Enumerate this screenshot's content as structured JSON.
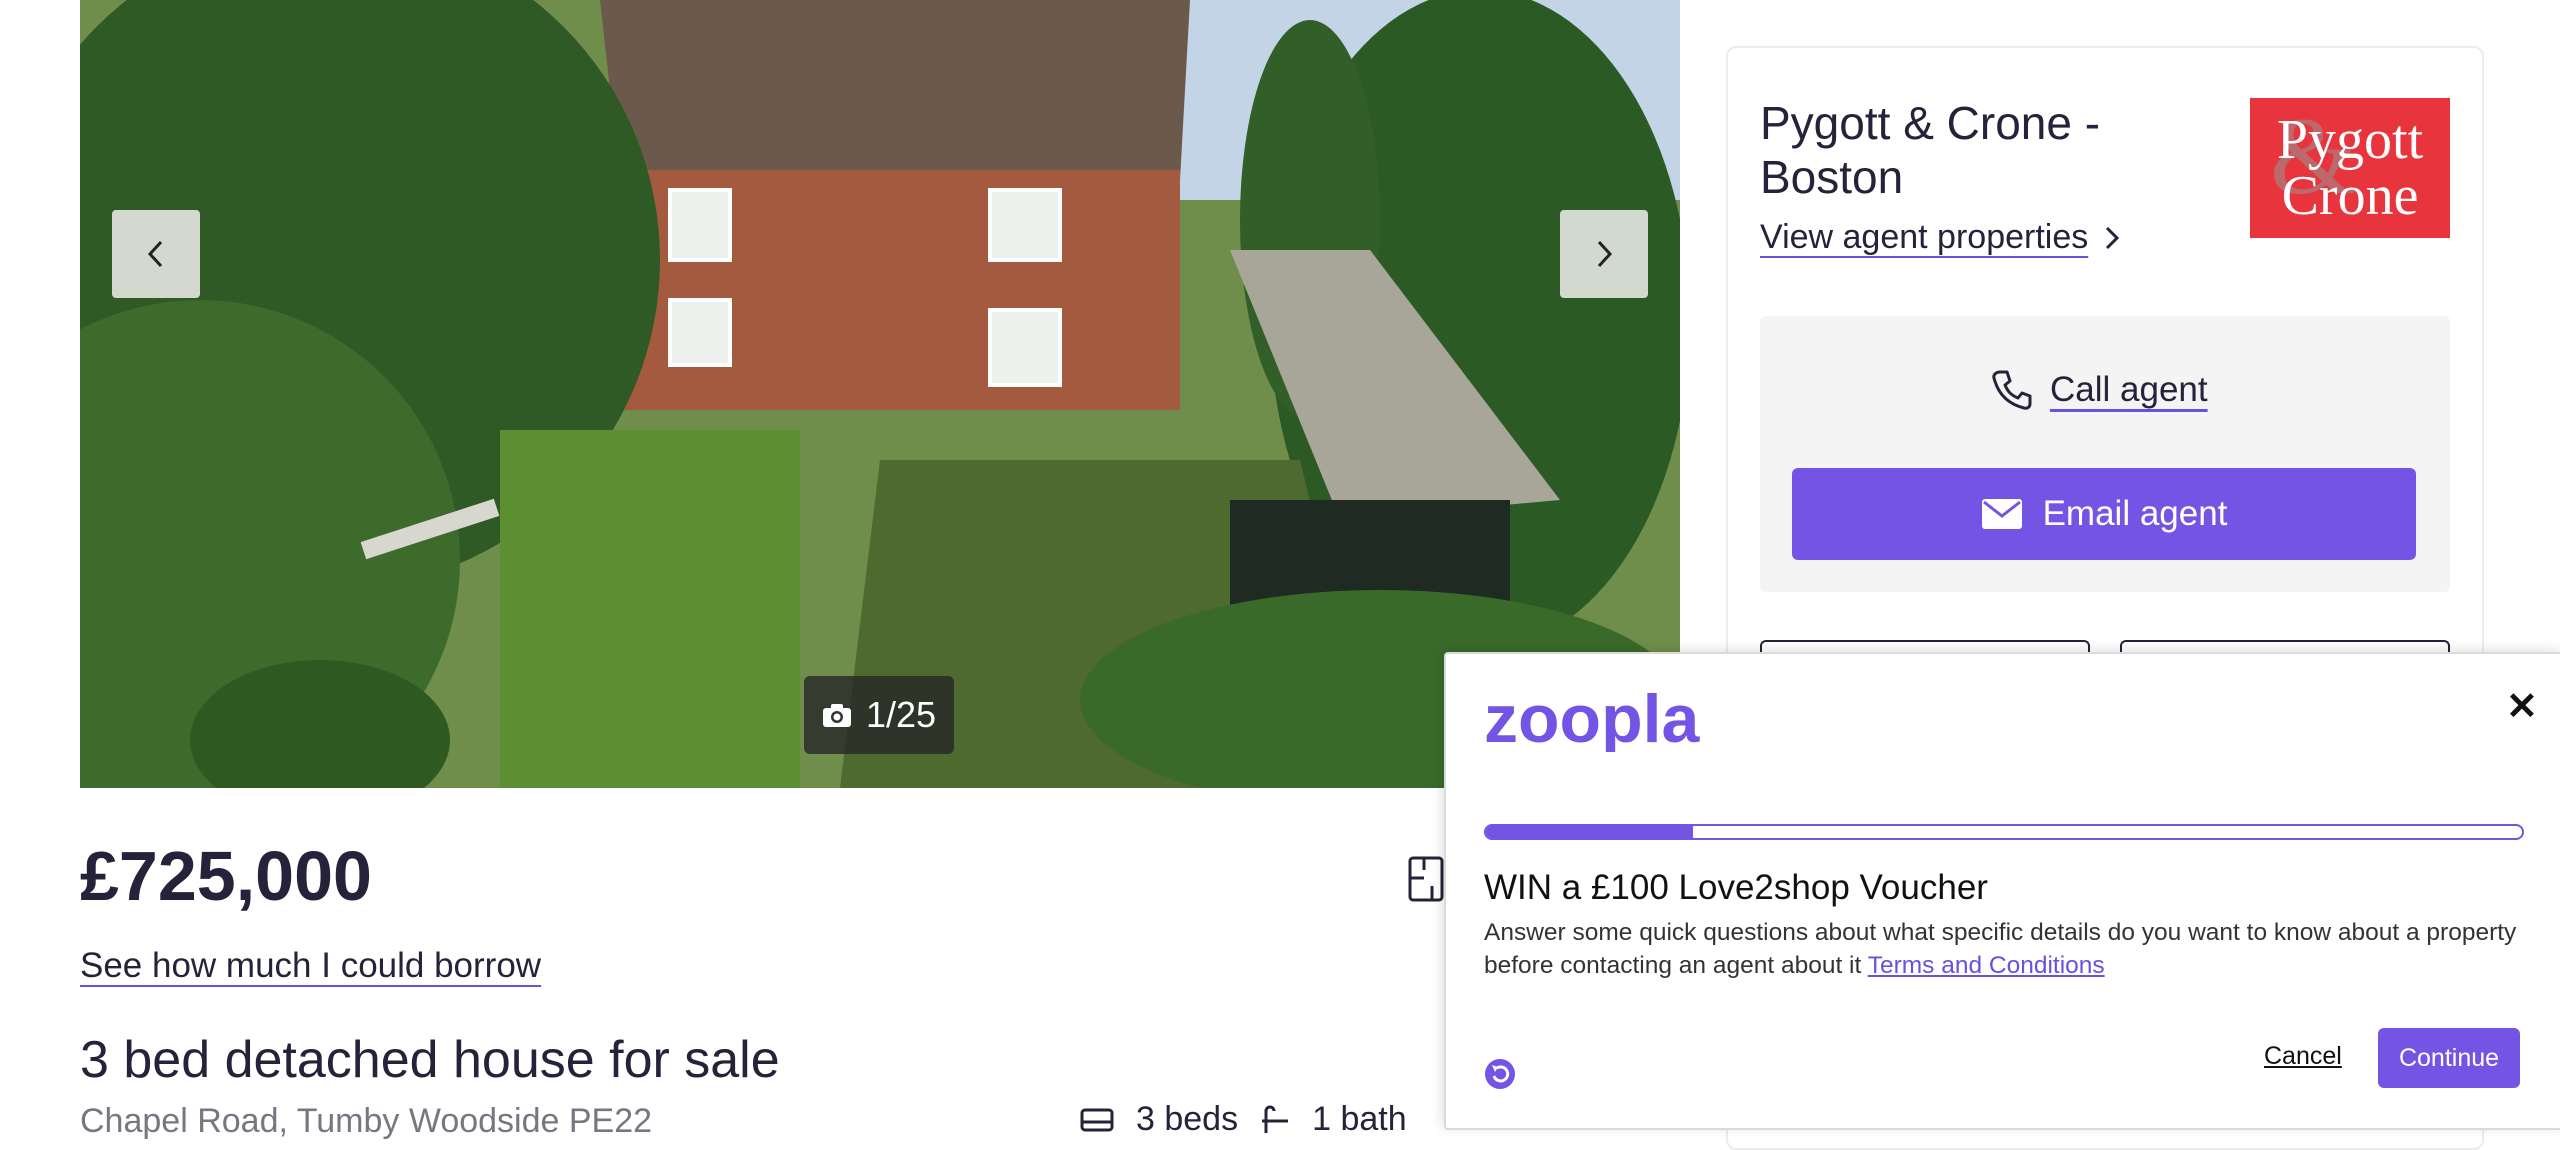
{
  "gallery": {
    "photo_counter": "1/25",
    "prev_icon": "chevron-left-icon",
    "next_icon": "chevron-right-icon",
    "camera_icon": "camera-icon"
  },
  "listing": {
    "price": "£725,000",
    "borrow_link": "See how much I could borrow",
    "title": "3 bed detached house for sale",
    "address": "Chapel Road, Tumby Woodside PE22",
    "beds": "3 beds",
    "baths": "1 bath"
  },
  "agent": {
    "name": "Pygott & Crone - Boston",
    "logo_line1": "Pygott",
    "logo_line2": "Crone",
    "view_properties": "View agent properties",
    "call_agent": "Call agent",
    "email_agent": "Email agent"
  },
  "modal": {
    "brand": "zoopla",
    "progress_percent": 20,
    "heading": "WIN a £100 Love2shop Voucher",
    "description": "Answer some quick questions about what specific details do you want to know about a property before contacting an agent about it",
    "terms_link": "Terms and Conditions",
    "cancel_label": "Cancel",
    "continue_label": "Continue",
    "close_label": "✕"
  },
  "colors": {
    "accent": "#7454e5",
    "text": "#28213a",
    "agent_logo_bg": "#e8343c"
  }
}
